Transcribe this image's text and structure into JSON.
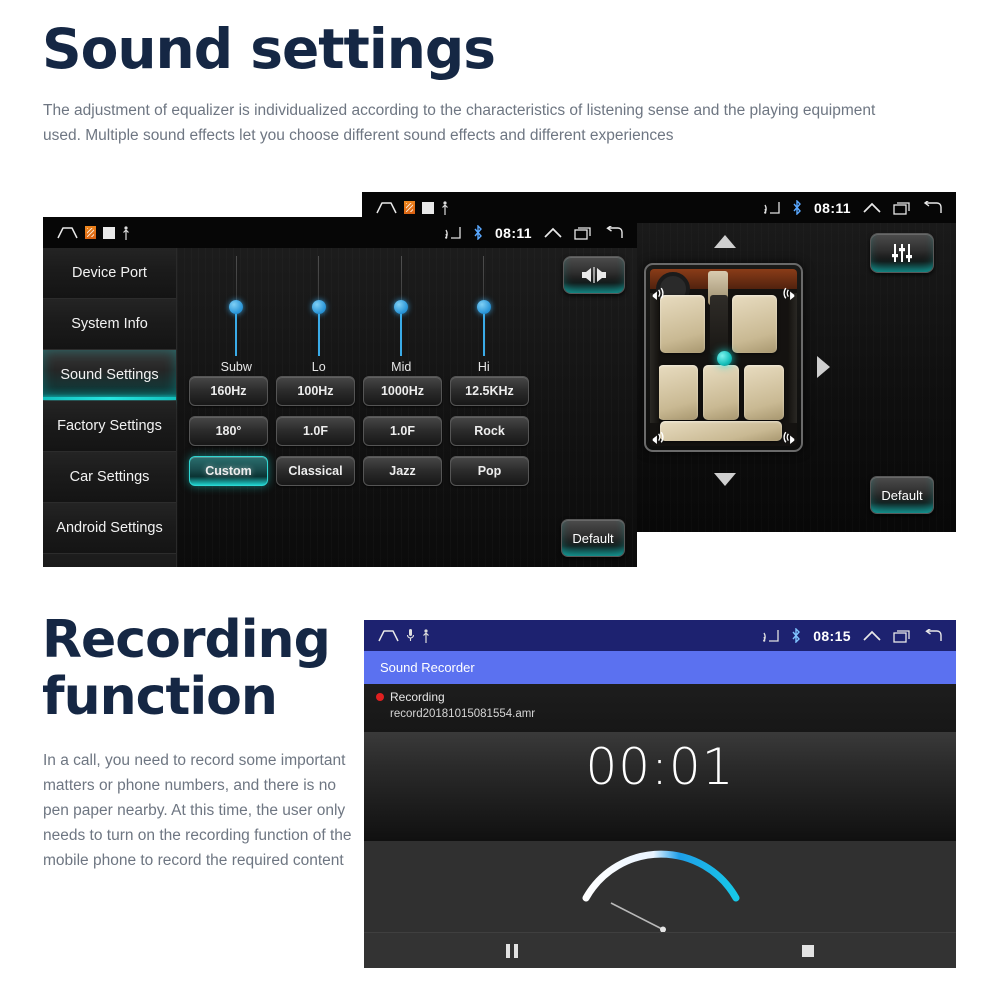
{
  "sections": {
    "sound": {
      "title": "Sound settings",
      "paragraph": "The adjustment of equalizer is individualized according to the characteristics of listening sense and the playing equipment used. Multiple sound effects let you choose different sound effects and different experiences"
    },
    "recording": {
      "title": "Recording function",
      "paragraph": "In a call, you need to record some important matters or phone numbers, and there is no pen paper nearby. At this time, the user only needs to turn on the recording function of the mobile phone to record the required content"
    }
  },
  "colors": {
    "heading": "#152744",
    "body_text": "#6e7682",
    "accent_teal": "#1ecfcb",
    "slider_blue": "#3aabe8",
    "recorder_appbar": "#5b71f0",
    "recorder_statusbar": "#1d2270",
    "record_dot": "#e02020"
  },
  "statusbar": {
    "time": "08:11",
    "icons_left": [
      "home-icon",
      "sd-card-icon",
      "storage-icon",
      "usb-icon"
    ],
    "icons_right": [
      "cast-icon",
      "bluetooth-icon",
      "chevron-up-icon",
      "recents-icon",
      "back-icon"
    ]
  },
  "statusbar_recorder": {
    "time": "08:15",
    "icons_left": [
      "home-icon",
      "microphone-icon",
      "usb-icon"
    ],
    "icons_right": [
      "cast-icon",
      "bluetooth-icon",
      "chevron-up-icon",
      "recents-icon",
      "back-icon"
    ]
  },
  "equalizer_screen": {
    "sidebar": [
      {
        "label": "Device Port",
        "active": false
      },
      {
        "label": "System Info",
        "active": false
      },
      {
        "label": "Sound Settings",
        "active": true
      },
      {
        "label": "Factory Settings",
        "active": false
      },
      {
        "label": "Car Settings",
        "active": false
      },
      {
        "label": "Android Settings",
        "active": false
      }
    ],
    "sliders": [
      {
        "label": "Subw",
        "value": 50
      },
      {
        "label": "Lo",
        "value": 50
      },
      {
        "label": "Mid",
        "value": 50
      },
      {
        "label": "Hi",
        "value": 50
      }
    ],
    "buttons": [
      {
        "label": "160Hz",
        "selected": false
      },
      {
        "label": "100Hz",
        "selected": false
      },
      {
        "label": "1000Hz",
        "selected": false
      },
      {
        "label": "12.5KHz",
        "selected": false
      },
      {
        "label": "180°",
        "selected": false
      },
      {
        "label": "1.0F",
        "selected": false
      },
      {
        "label": "1.0F",
        "selected": false
      },
      {
        "label": "Rock",
        "selected": false
      },
      {
        "label": "Custom",
        "selected": true
      },
      {
        "label": "Classical",
        "selected": false
      },
      {
        "label": "Jazz",
        "selected": false
      },
      {
        "label": "Pop",
        "selected": false
      }
    ],
    "balance_icon": "speaker-balance-icon",
    "default_label": "Default"
  },
  "balance_screen": {
    "equalizer_icon": "equalizer-sliders-icon",
    "default_label": "Default",
    "arrows": [
      "arrow-up-icon",
      "arrow-down-icon",
      "arrow-right-icon"
    ],
    "speakers": [
      "speaker-front-left",
      "speaker-front-right",
      "speaker-rear-left",
      "speaker-rear-right"
    ],
    "position_marker": "balance-position-dot"
  },
  "recorder_screen": {
    "app_title": "Sound Recorder",
    "status_label": "Recording",
    "file_name": "record20181015081554.amr",
    "timer": "00:01",
    "controls": [
      {
        "name": "pause-button",
        "icon": "pause-icon"
      },
      {
        "name": "stop-button",
        "icon": "stop-icon"
      }
    ]
  }
}
